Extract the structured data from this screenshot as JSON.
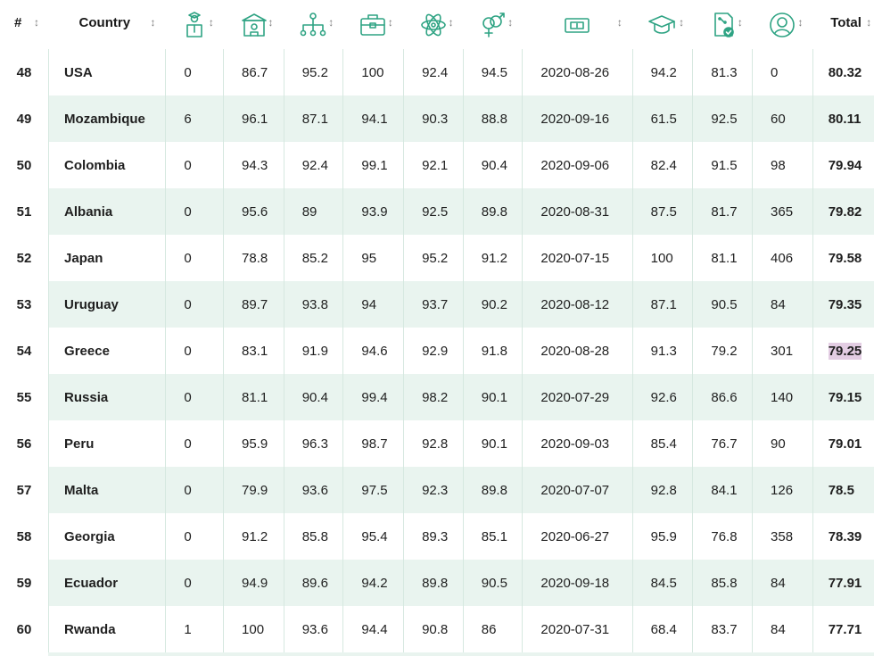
{
  "header": {
    "rank_label": "#",
    "country_label": "Country",
    "total_label": "Total",
    "sort_glyph": "↕",
    "icons": [
      "graduation-person-icon",
      "school-building-icon",
      "org-hierarchy-icon",
      "briefcase-icon",
      "atom-icon",
      "gender-symbols-icon",
      "banknote-icon",
      "graduation-cap-icon",
      "percent-document-icon",
      "person-portrait-icon"
    ],
    "accent_color": "#2ea383"
  },
  "rows": [
    {
      "rank": "48",
      "country": "USA",
      "c1": "0",
      "c2": "86.7",
      "c3": "95.2",
      "c4": "100",
      "c5": "92.4",
      "c6": "94.5",
      "date": "2020-08-26",
      "c8": "94.2",
      "c9": "81.3",
      "c10": "0",
      "total": "80.32"
    },
    {
      "rank": "49",
      "country": "Mozambique",
      "c1": "6",
      "c2": "96.1",
      "c3": "87.1",
      "c4": "94.1",
      "c5": "90.3",
      "c6": "88.8",
      "date": "2020-09-16",
      "c8": "61.5",
      "c9": "92.5",
      "c10": "60",
      "total": "80.11"
    },
    {
      "rank": "50",
      "country": "Colombia",
      "c1": "0",
      "c2": "94.3",
      "c3": "92.4",
      "c4": "99.1",
      "c5": "92.1",
      "c6": "90.4",
      "date": "2020-09-06",
      "c8": "82.4",
      "c9": "91.5",
      "c10": "98",
      "total": "79.94"
    },
    {
      "rank": "51",
      "country": "Albania",
      "c1": "0",
      "c2": "95.6",
      "c3": "89",
      "c4": "93.9",
      "c5": "92.5",
      "c6": "89.8",
      "date": "2020-08-31",
      "c8": "87.5",
      "c9": "81.7",
      "c10": "365",
      "total": "79.82"
    },
    {
      "rank": "52",
      "country": "Japan",
      "c1": "0",
      "c2": "78.8",
      "c3": "85.2",
      "c4": "95",
      "c5": "95.2",
      "c6": "91.2",
      "date": "2020-07-15",
      "c8": "100",
      "c9": "81.1",
      "c10": "406",
      "total": "79.58"
    },
    {
      "rank": "53",
      "country": "Uruguay",
      "c1": "0",
      "c2": "89.7",
      "c3": "93.8",
      "c4": "94",
      "c5": "93.7",
      "c6": "90.2",
      "date": "2020-08-12",
      "c8": "87.1",
      "c9": "90.5",
      "c10": "84",
      "total": "79.35"
    },
    {
      "rank": "54",
      "country": "Greece",
      "c1": "0",
      "c2": "83.1",
      "c3": "91.9",
      "c4": "94.6",
      "c5": "92.9",
      "c6": "91.8",
      "date": "2020-08-28",
      "c8": "91.3",
      "c9": "79.2",
      "c10": "301",
      "total": "79.25",
      "highlight": true
    },
    {
      "rank": "55",
      "country": "Russia",
      "c1": "0",
      "c2": "81.1",
      "c3": "90.4",
      "c4": "99.4",
      "c5": "98.2",
      "c6": "90.1",
      "date": "2020-07-29",
      "c8": "92.6",
      "c9": "86.6",
      "c10": "140",
      "total": "79.15"
    },
    {
      "rank": "56",
      "country": "Peru",
      "c1": "0",
      "c2": "95.9",
      "c3": "96.3",
      "c4": "98.7",
      "c5": "92.8",
      "c6": "90.1",
      "date": "2020-09-03",
      "c8": "85.4",
      "c9": "76.7",
      "c10": "90",
      "total": "79.01"
    },
    {
      "rank": "57",
      "country": "Malta",
      "c1": "0",
      "c2": "79.9",
      "c3": "93.6",
      "c4": "97.5",
      "c5": "92.3",
      "c6": "89.8",
      "date": "2020-07-07",
      "c8": "92.8",
      "c9": "84.1",
      "c10": "126",
      "total": "78.5"
    },
    {
      "rank": "58",
      "country": "Georgia",
      "c1": "0",
      "c2": "91.2",
      "c3": "85.8",
      "c4": "95.4",
      "c5": "89.3",
      "c6": "85.1",
      "date": "2020-06-27",
      "c8": "95.9",
      "c9": "76.8",
      "c10": "358",
      "total": "78.39"
    },
    {
      "rank": "59",
      "country": "Ecuador",
      "c1": "0",
      "c2": "94.9",
      "c3": "89.6",
      "c4": "94.2",
      "c5": "89.8",
      "c6": "90.5",
      "date": "2020-09-18",
      "c8": "84.5",
      "c9": "85.8",
      "c10": "84",
      "total": "77.91"
    },
    {
      "rank": "60",
      "country": "Rwanda",
      "c1": "1",
      "c2": "100",
      "c3": "93.6",
      "c4": "94.4",
      "c5": "90.8",
      "c6": "86",
      "date": "2020-07-31",
      "c8": "68.4",
      "c9": "83.7",
      "c10": "84",
      "total": "77.71"
    }
  ]
}
